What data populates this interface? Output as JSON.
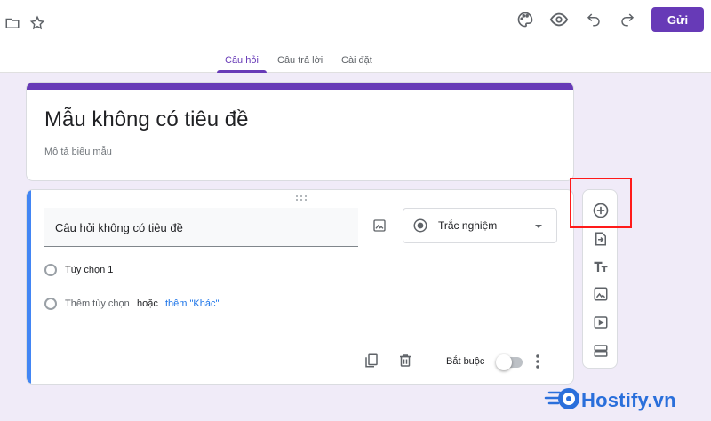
{
  "header": {
    "send_label": "Gửi",
    "icons": [
      "folder-icon",
      "star-icon",
      "palette-icon",
      "preview-eye-icon",
      "undo-icon",
      "redo-icon"
    ]
  },
  "tabs": [
    {
      "label": "Câu hỏi",
      "active": true
    },
    {
      "label": "Câu trả lời",
      "active": false
    },
    {
      "label": "Cài đặt",
      "active": false
    }
  ],
  "form": {
    "title": "Mẫu không có tiêu đề",
    "description_placeholder": "Mô tả biểu mẫu"
  },
  "question": {
    "title": "Câu hỏi không có tiêu đề",
    "type": "Trắc nghiệm",
    "options": [
      "Tùy chọn 1"
    ],
    "add_option": "Thêm tùy chọn",
    "or": "hoặc",
    "add_other": "thêm \"Khác\"",
    "required_label": "Bắt buộc",
    "required": false
  },
  "side_toolbar": {
    "items": [
      "add-question-icon",
      "import-questions-icon",
      "add-title-icon",
      "add-image-icon",
      "add-video-icon",
      "add-section-icon"
    ]
  },
  "watermark": {
    "text": "Hostify.vn"
  },
  "colors": {
    "accent": "#673ab7",
    "background": "#f0ebf8",
    "question_accent": "#4285f4",
    "highlight": "#ff1a1a",
    "watermark": "#2a6fdb"
  }
}
